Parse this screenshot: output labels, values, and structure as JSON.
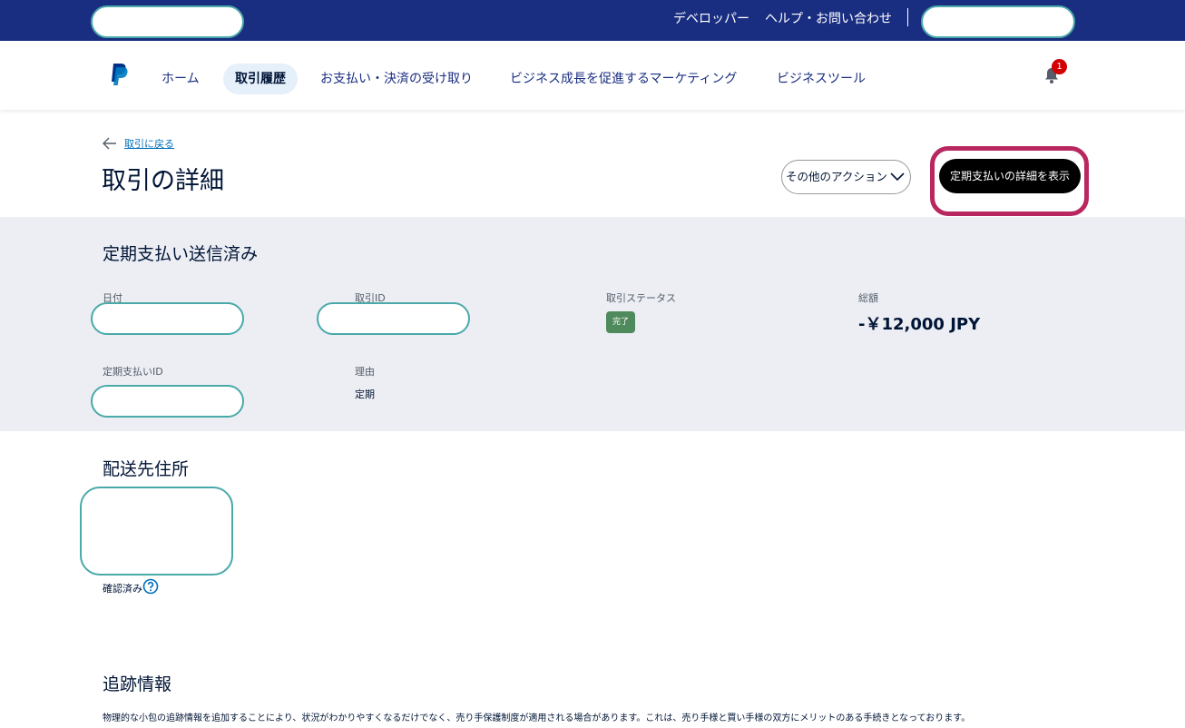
{
  "topbar": {
    "links": [
      "デベロッパー",
      "ヘルプ・お問い合わせ"
    ]
  },
  "nav": {
    "logo": "paypal-logo",
    "items": [
      {
        "label": "ホーム",
        "active": false
      },
      {
        "label": "取引履歴",
        "active": true
      },
      {
        "label": "お支払い・決済の受け取り",
        "active": false
      },
      {
        "label": "ビジネス成長を促進するマーケティング",
        "active": false
      },
      {
        "label": "ビジネスツール",
        "active": false
      }
    ],
    "notification_count": "1"
  },
  "header": {
    "back_label": "取引に戻る",
    "title": "取引の詳細",
    "actions_label": "その他のアクション",
    "primary_label": "定期支払いの詳細を表示"
  },
  "summary": {
    "title": "定期支払い送信済み",
    "date_label": "日付",
    "txn_id_label": "取引ID",
    "status_label": "取引ステータス",
    "status_value": "完了",
    "total_label": "総額",
    "total_value": "-￥12,000 JPY",
    "recurring_id_label": "定期支払いID",
    "reason_label": "理由",
    "reason_value": "定期"
  },
  "shipping": {
    "title": "配送先住所",
    "verified_label": "確認済み"
  },
  "tracking": {
    "title": "追跡情報",
    "description": "物理的な小包の追跡情報を追加することにより、状況がわかりやすくなるだけでなく、売り手保護制度が適用される場合があります。これは、売り手様と買い手様の双方にメリットのある手続きとなっております。"
  },
  "colors": {
    "topbar": "#1a2e81",
    "highlight": "#b8275f",
    "status_badge": "#4f8a5c",
    "redaction_border": "#4aa9a9"
  }
}
